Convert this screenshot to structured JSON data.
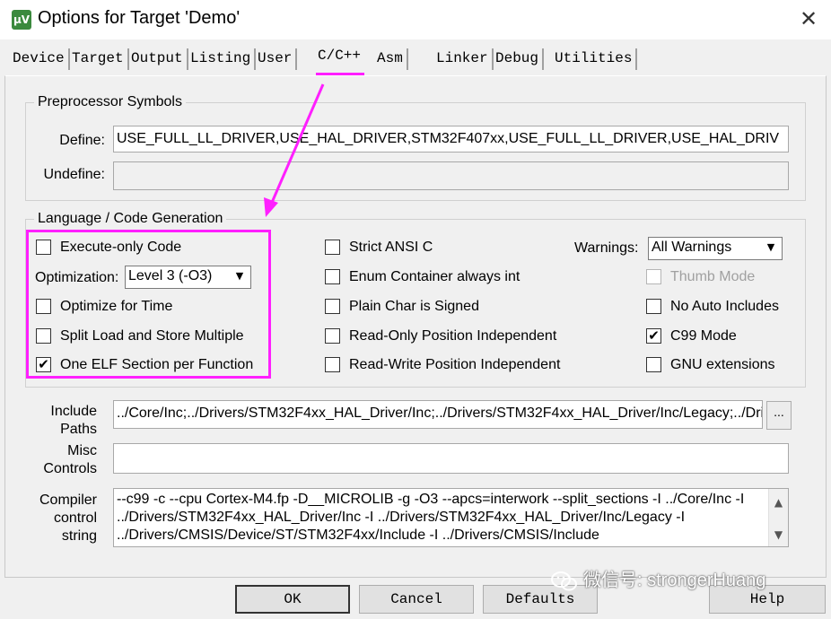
{
  "window": {
    "title": "Options for Target 'Demo'",
    "app_icon_text": "µV",
    "close_glyph": "✕"
  },
  "tabs": [
    {
      "label": "Device"
    },
    {
      "label": "Target"
    },
    {
      "label": "Output"
    },
    {
      "label": "Listing"
    },
    {
      "label": "User"
    },
    {
      "label": "C/C++"
    },
    {
      "label": "Asm"
    },
    {
      "label": "Linker"
    },
    {
      "label": "Debug"
    },
    {
      "label": "Utilities"
    }
  ],
  "active_tab": "C/C++",
  "preprocessor": {
    "group_label": "Preprocessor Symbols",
    "define_label": "Define:",
    "define_value": "USE_FULL_LL_DRIVER,USE_HAL_DRIVER,STM32F407xx,USE_FULL_LL_DRIVER,USE_HAL_DRIV",
    "undefine_label": "Undefine:",
    "undefine_value": ""
  },
  "codegen": {
    "group_label": "Language / Code Generation",
    "execute_only": {
      "label": "Execute-only Code",
      "checked": false
    },
    "optimization_label": "Optimization:",
    "optimization_value": "Level 3 (-O3)",
    "optimize_time": {
      "label": "Optimize for Time",
      "checked": false
    },
    "split_load": {
      "label": "Split Load and Store Multiple",
      "checked": false
    },
    "one_elf": {
      "label": "One ELF Section per Function",
      "checked": true
    },
    "strict_ansi": {
      "label": "Strict ANSI C",
      "checked": false
    },
    "enum_container": {
      "label": "Enum Container always int",
      "checked": false
    },
    "plain_char": {
      "label": "Plain Char is Signed",
      "checked": false
    },
    "ro_position": {
      "label": "Read-Only Position Independent",
      "checked": false
    },
    "rw_position": {
      "label": "Read-Write Position Independent",
      "checked": false
    },
    "warnings_label": "Warnings:",
    "warnings_value": "All Warnings",
    "thumb_mode": {
      "label": "Thumb Mode",
      "checked": false
    },
    "no_auto_includes": {
      "label": "No Auto Includes",
      "checked": false
    },
    "c99_mode": {
      "label": "C99 Mode",
      "checked": true
    },
    "gnu_extensions": {
      "label": "GNU extensions",
      "checked": false
    }
  },
  "include_paths": {
    "label_line1": "Include",
    "label_line2": "Paths",
    "value": "../Core/Inc;../Drivers/STM32F4xx_HAL_Driver/Inc;../Drivers/STM32F4xx_HAL_Driver/Inc/Legacy;../Drive",
    "browse_label": "..."
  },
  "misc_controls": {
    "label_line1": "Misc",
    "label_line2": "Controls",
    "value": ""
  },
  "compiler_string": {
    "label_line1": "Compiler",
    "label_line2": "control",
    "label_line3": "string",
    "lines": [
      "--c99 -c --cpu Cortex-M4.fp -D__MICROLIB -g -O3 --apcs=interwork --split_sections -I ../Core/Inc -I",
      "../Drivers/STM32F4xx_HAL_Driver/Inc -I ../Drivers/STM32F4xx_HAL_Driver/Inc/Legacy -I",
      "../Drivers/CMSIS/Device/ST/STM32F4xx/Include -I ../Drivers/CMSIS/Include"
    ]
  },
  "buttons": {
    "ok": "OK",
    "cancel": "Cancel",
    "defaults": "Defaults",
    "help": "Help"
  },
  "watermark": {
    "text": "微信号: strongerHuang",
    "icon": "wechat-icon"
  },
  "colors": {
    "annotation": "#ff1fff",
    "dialog_bg": "#f0f0f0"
  }
}
